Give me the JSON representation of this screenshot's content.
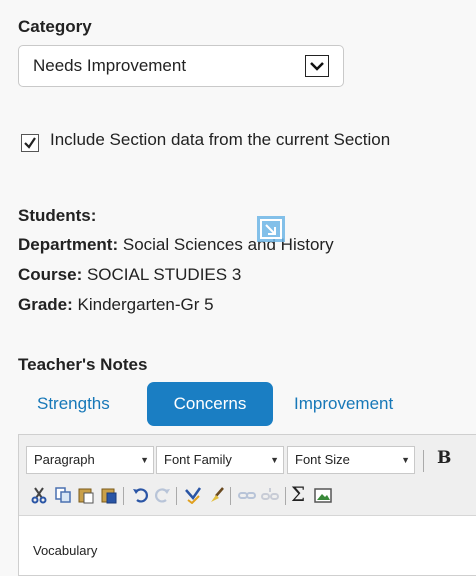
{
  "category": {
    "label": "Category",
    "selected": "Needs Improvement"
  },
  "include_section": {
    "checked": true,
    "label": "Include Section data from the current Section"
  },
  "info": {
    "students_label": "Students:",
    "department_label": "Department:",
    "department_value": "Social Sciences and History",
    "course_label": "Course:",
    "course_value": "SOCIAL STUDIES 3",
    "grade_label": "Grade:",
    "grade_value": "Kindergarten-Gr 5"
  },
  "notes": {
    "heading": "Teacher's Notes",
    "tabs": [
      {
        "label": "Strengths",
        "active": false
      },
      {
        "label": "Concerns",
        "active": true
      },
      {
        "label": "Improvement",
        "active": false
      }
    ]
  },
  "editor": {
    "format_select": "Paragraph",
    "font_family_select": "Font Family",
    "font_size_select": "Font Size",
    "bold_label": "B",
    "sum_label": "Σ",
    "content": "Vocabulary",
    "icons": [
      "cut-icon",
      "copy-icon",
      "paste-icon",
      "paste-word-icon",
      "undo-icon",
      "redo-icon",
      "spellcheck-icon",
      "cleanup-icon",
      "link-icon",
      "unlink-icon",
      "sum-icon",
      "image-icon"
    ]
  },
  "colors": {
    "accent": "#1a7ec3",
    "tab_text": "#1778b8"
  }
}
